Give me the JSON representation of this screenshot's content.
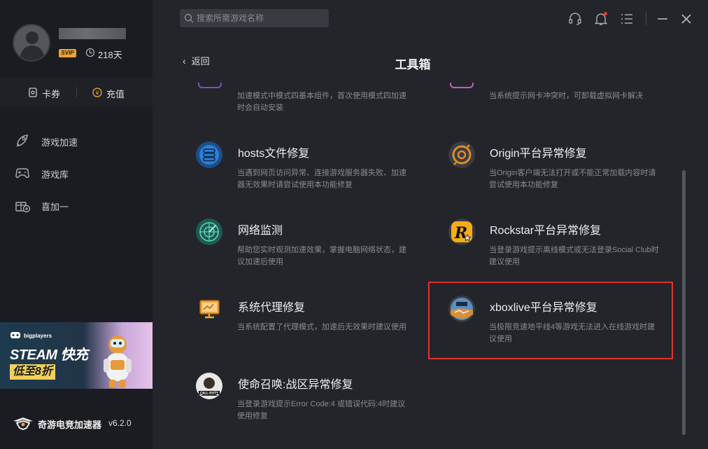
{
  "user": {
    "vip_badge": "SVIP",
    "days": "218天"
  },
  "wallet": {
    "coupon": "卡券",
    "recharge": "充值"
  },
  "nav": [
    {
      "label": "游戏加速",
      "icon": "rocket-icon"
    },
    {
      "label": "游戏库",
      "icon": "gamepad-icon"
    },
    {
      "label": "喜加一",
      "icon": "gift-plus-icon"
    }
  ],
  "banner": {
    "brand": "bigplayers",
    "headline": "STEAM 快充",
    "offer": "低至8折"
  },
  "app": {
    "name": "奇游电竞加速器",
    "version": "v6.2.0"
  },
  "search": {
    "placeholder": "搜索所需游戏名称"
  },
  "page": {
    "back": "返回",
    "title": "工具箱"
  },
  "tools_top": [
    {
      "desc": "加速模式中模式四基本组件，首次使用模式四加速时会自动安装"
    },
    {
      "desc": "当系统提示网卡冲突时，可卸载虚拟网卡解决"
    }
  ],
  "tools": [
    {
      "name": "hosts文件修复",
      "desc": "当遇到网页访问异常、连接游戏服务器失败、加速器无效果时请尝试使用本功能修复",
      "icon": "database-repair-icon"
    },
    {
      "name": "Origin平台异常修复",
      "desc": "当Origin客户端无法打开或不能正常加载内容时请尝试使用本功能修复",
      "icon": "origin-icon"
    },
    {
      "name": "网络监测",
      "desc": "帮助您实时观测加速效果，掌握电脑网络状态，建议加速后使用",
      "icon": "radar-icon"
    },
    {
      "name": "Rockstar平台异常修复",
      "desc": "当登录游戏提示离线模式或无法登录Social Club时建议使用",
      "icon": "rockstar-icon"
    },
    {
      "name": "系统代理修复",
      "desc": "当系统配置了代理模式，加速后无效果时建议使用",
      "icon": "monitor-proxy-icon"
    },
    {
      "name": "xboxlive平台异常修复",
      "desc": "当极限竞速地平线4等游戏无法进入在线游戏时建议使用",
      "icon": "forza-icon"
    },
    {
      "name": "使命召唤:战区异常修复",
      "desc": "当登录游戏提示Error Code:4 或错误代码:4时建议使用修复",
      "icon": "call-of-duty-icon"
    }
  ],
  "colors": {
    "highlight": "#e0322e",
    "accent_orange": "#f0a73a",
    "vip": "#e8a33a"
  }
}
